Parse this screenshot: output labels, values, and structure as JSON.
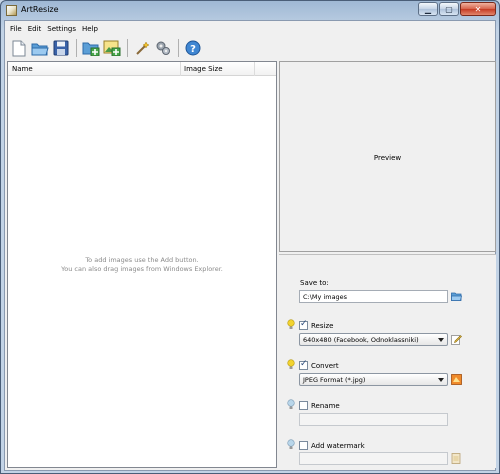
{
  "window": {
    "title": "ArtResize",
    "icon": "artresize-app-icon",
    "controls": [
      "minimize-icon",
      "maximize-icon",
      "close-icon"
    ]
  },
  "menu": {
    "items": [
      "File",
      "Edit",
      "Settings",
      "Help"
    ]
  },
  "toolbar": {
    "buttons": [
      {
        "icon": "new-icon"
      },
      {
        "icon": "open-folder-icon"
      },
      {
        "icon": "save-icon"
      },
      {
        "icon": "add-folder-icon"
      },
      {
        "icon": "add-image-icon"
      },
      {
        "icon": "wand-icon"
      },
      {
        "icon": "gears-icon"
      },
      {
        "icon": "help-icon"
      }
    ]
  },
  "list": {
    "columns": [
      "Name",
      "Image Size"
    ],
    "hint_line1": "To add images use the Add button.",
    "hint_line2": "You can also drag images from Windows Explorer."
  },
  "preview": {
    "label": "Preview"
  },
  "options": {
    "save_to_label": "Save to:",
    "save_to_value": "C:\\My images",
    "resize_label": "Resize",
    "resize_checked": true,
    "resize_value": "640x480 (Facebook, Odnoklassniki)",
    "convert_label": "Convert",
    "convert_checked": true,
    "convert_value": "JPEG Format (*.jpg)",
    "rename_label": "Rename",
    "rename_checked": false,
    "rename_value": "",
    "watermark_label": "Add watermark",
    "watermark_checked": false,
    "watermark_value": ""
  },
  "colors": {
    "bulb_on": "#f2d330",
    "bulb_off": "#b9d6ea",
    "accent_blue": "#2f6fb8"
  }
}
